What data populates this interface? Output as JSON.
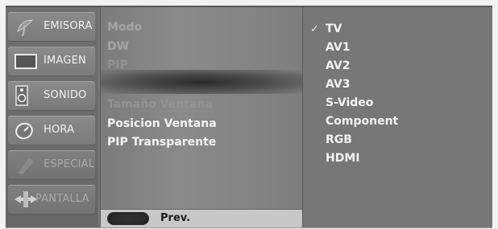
{
  "sidebar": {
    "items": [
      {
        "label": "EMISORA",
        "icon": "satellite-dish-icon"
      },
      {
        "label": "IMAGEN",
        "icon": "monitor-icon"
      },
      {
        "label": "SONIDO",
        "icon": "speaker-icon"
      },
      {
        "label": "HORA",
        "icon": "clock-icon"
      },
      {
        "label": "ESPECIAL",
        "icon": "special-icon"
      },
      {
        "label": "PANTALLA",
        "icon": "screen-adjust-icon"
      }
    ]
  },
  "submenu": {
    "items": [
      {
        "label": "Modo"
      },
      {
        "label": "DW"
      },
      {
        "label": "PIP"
      },
      {
        "label": "Tamaño Ventana"
      },
      {
        "label": "Posicion Ventana"
      },
      {
        "label": "PIP Transparente"
      }
    ],
    "prev_label": "Prev."
  },
  "options": {
    "check_mark": "✓",
    "items": [
      "TV",
      "AV1",
      "AV2",
      "AV3",
      "S-Video",
      "Component",
      "RGB",
      "HDMI"
    ],
    "selected_index": 0
  }
}
